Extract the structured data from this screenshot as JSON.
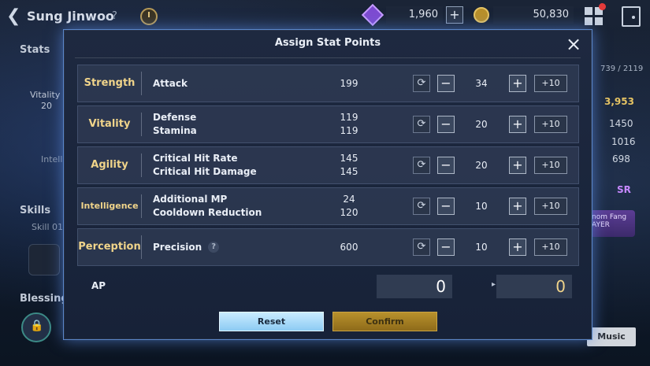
{
  "background": {
    "character_name": "Sung Jinwoo",
    "help_mark": "?",
    "crystal_amount": "1,960",
    "plus_label": "+",
    "gold_amount": "50,830",
    "left_panel": {
      "stats_label": "Stats",
      "vitality_label": "Vitality",
      "vitality_value": "20",
      "intel_label": "Intell",
      "skills_label": "Skills",
      "skill_label": "Skill 01",
      "blessing_label": "Blessing"
    },
    "right_panel": {
      "counter": "739 / 2119",
      "power": "3,953",
      "val1": "1450",
      "val2": "1016",
      "val3": "698",
      "rank_badge": "SR",
      "item_name": "nom Fang",
      "item_sub": "AYER",
      "music_label": "Music"
    }
  },
  "modal": {
    "title": "Assign Stat Points",
    "close_symbol": "×",
    "stats": [
      {
        "name": "Strength",
        "subs": [
          {
            "label": "Attack",
            "value": "199"
          }
        ],
        "amount": "34"
      },
      {
        "name": "Vitality",
        "subs": [
          {
            "label": "Defense",
            "value": "119"
          },
          {
            "label": "Stamina",
            "value": "119"
          }
        ],
        "amount": "20"
      },
      {
        "name": "Agility",
        "subs": [
          {
            "label": "Critical Hit Rate",
            "value": "145"
          },
          {
            "label": "Critical Hit Damage",
            "value": "145"
          }
        ],
        "amount": "20"
      },
      {
        "name": "Intelligence",
        "subs": [
          {
            "label": "Additional MP",
            "value": "24"
          },
          {
            "label": "Cooldown Reduction",
            "value": "120"
          }
        ],
        "amount": "10"
      },
      {
        "name": "Perception",
        "subs": [
          {
            "label": "Precision",
            "value": "600"
          }
        ],
        "amount": "10"
      }
    ],
    "controls": {
      "minus": "−",
      "plus": "+",
      "plus_ten": "+10",
      "reset_symbol": "⟳"
    },
    "ap": {
      "label": "AP",
      "current": "0",
      "after": "0",
      "arrow": "▸"
    },
    "buttons": {
      "reset": "Reset",
      "confirm": "Confirm"
    }
  },
  "colors": {
    "stat_name": "#f0d48a",
    "confirm": "#b8912c",
    "reset": "#8dcbf3",
    "accent_gold": "#e5c363"
  }
}
